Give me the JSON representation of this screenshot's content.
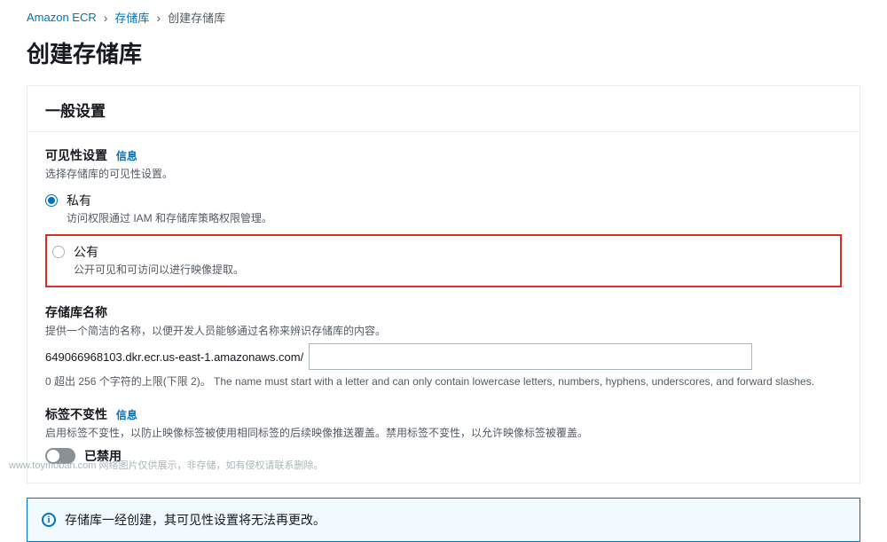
{
  "breadcrumb": {
    "items": [
      "Amazon ECR",
      "存储库",
      "创建存储库"
    ]
  },
  "page_title": "创建存储库",
  "panel": {
    "header": "一般设置",
    "visibility": {
      "label": "可见性设置",
      "info": "信息",
      "desc": "选择存储库的可见性设置。",
      "options": [
        {
          "label": "私有",
          "desc": "访问权限通过 IAM 和存储库策略权限管理。",
          "checked": true
        },
        {
          "label": "公有",
          "desc": "公开可见和可访问以进行映像提取。",
          "checked": false
        }
      ]
    },
    "repo_name": {
      "label": "存储库名称",
      "desc": "提供一个简洁的名称，以便开发人员能够通过名称来辨识存储库的内容。",
      "prefix": "649066968103.dkr.ecr.us-east-1.amazonaws.com/",
      "value": "",
      "hint": "0 超出 256 个字符的上限(下限 2)。 The name must start with a letter and can only contain lowercase letters, numbers, hyphens, underscores, and forward slashes."
    },
    "immutability": {
      "label": "标签不变性",
      "info": "信息",
      "desc": "启用标签不变性，以防止映像标签被使用相同标签的后续映像推送覆盖。禁用标签不变性，以允许映像标签被覆盖。",
      "toggle_label": "已禁用"
    }
  },
  "alert": {
    "text": "存储库一经创建，其可见性设置将无法再更改。"
  },
  "watermark": "www.toymoban.com  网络图片仅供展示，非存储，如有侵权请联系删除。"
}
